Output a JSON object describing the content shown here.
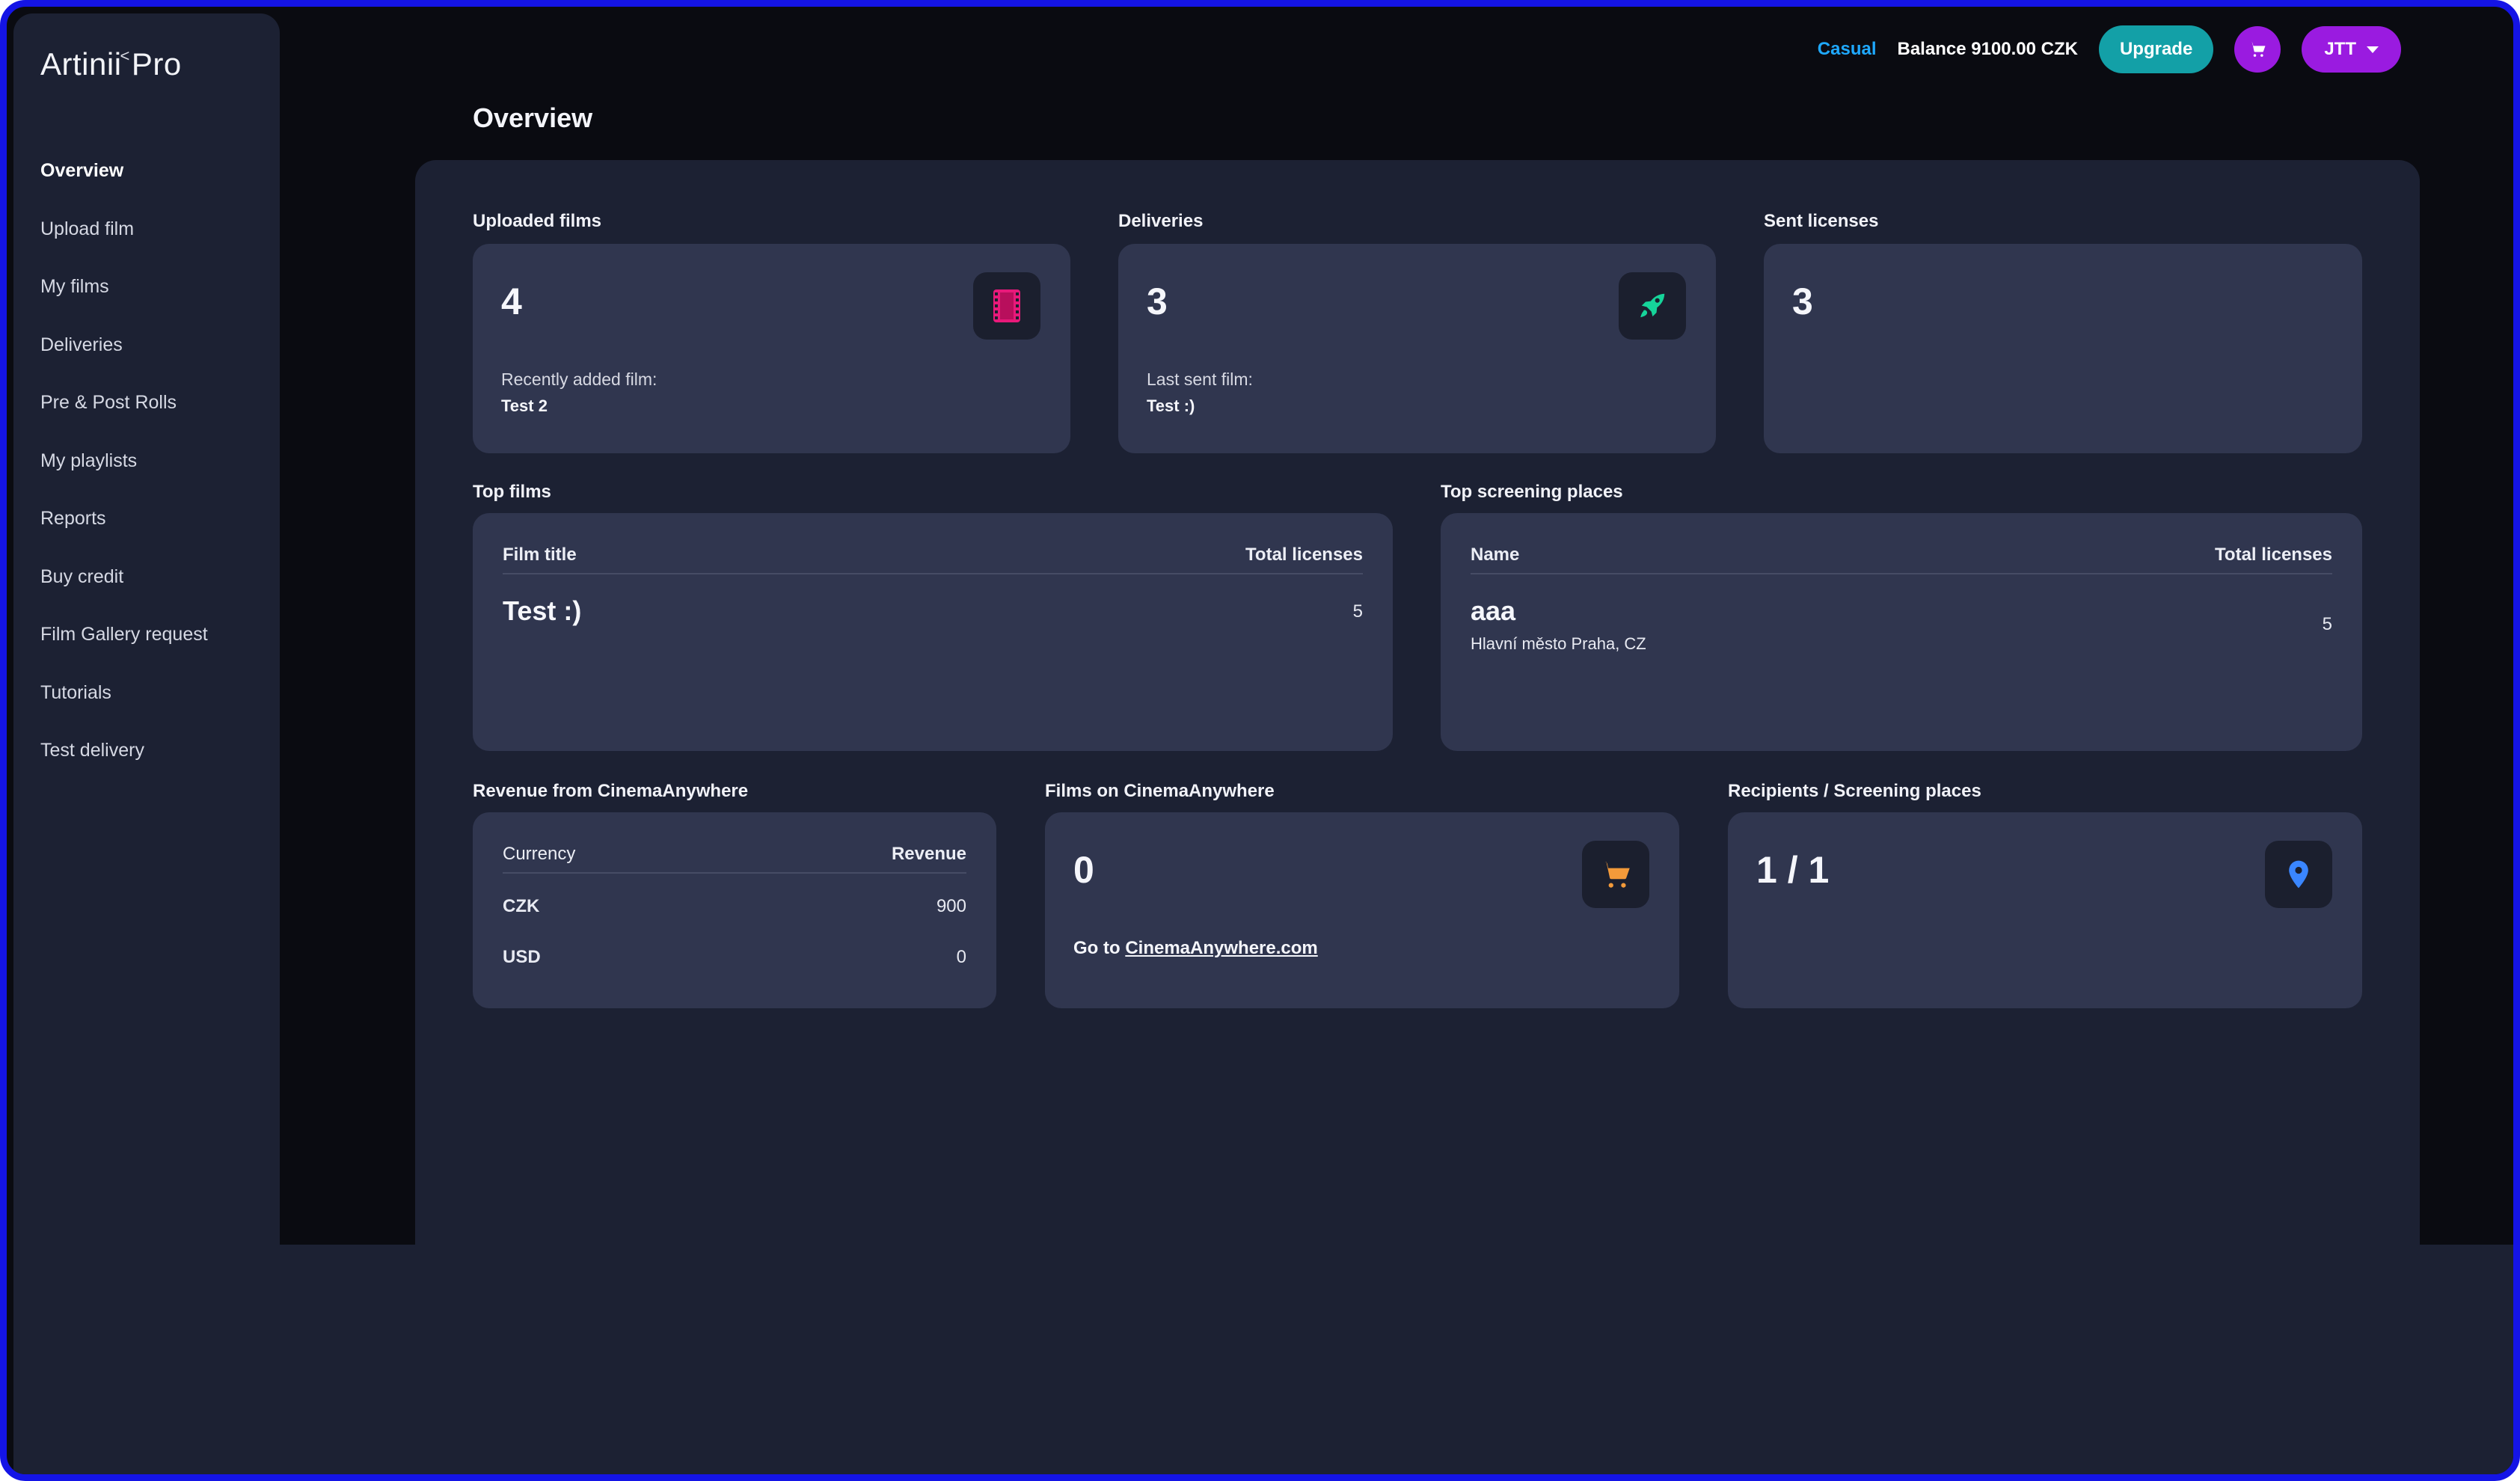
{
  "app": {
    "logo": "Artinii",
    "logo_suffix": "Pro",
    "logo_mark": "˂"
  },
  "sidebar": {
    "items": [
      {
        "label": "Overview",
        "active": true
      },
      {
        "label": "Upload film"
      },
      {
        "label": "My films"
      },
      {
        "label": "Deliveries"
      },
      {
        "label": "Pre & Post Rolls"
      },
      {
        "label": "My playlists"
      },
      {
        "label": "Reports"
      },
      {
        "label": "Buy credit"
      },
      {
        "label": "Film Gallery request"
      },
      {
        "label": "Tutorials"
      },
      {
        "label": "Test delivery"
      }
    ]
  },
  "topbar": {
    "plan": "Casual",
    "balance": "Balance 9100.00 CZK",
    "upgrade_label": "Upgrade",
    "cart_icon": "cart-icon",
    "user_label": "JTT"
  },
  "page": {
    "title": "Overview"
  },
  "stats": {
    "uploaded": {
      "label": "Uploaded films",
      "value": "4",
      "sub_label": "Recently added film:",
      "sub_value": "Test 2",
      "icon": "film-icon",
      "icon_color": "#e8197a"
    },
    "deliveries": {
      "label": "Deliveries",
      "value": "3",
      "sub_label": "Last sent film:",
      "sub_value": "Test :)",
      "icon": "rocket-icon",
      "icon_color": "#16d49a"
    },
    "licenses": {
      "label": "Sent licenses",
      "value": "3"
    }
  },
  "top_films": {
    "label": "Top films",
    "columns": [
      "Film title",
      "Total licenses"
    ],
    "rows": [
      {
        "title": "Test :)",
        "licenses": "5"
      }
    ]
  },
  "top_places": {
    "label": "Top screening places",
    "columns": [
      "Name",
      "Total licenses"
    ],
    "rows": [
      {
        "name": "aaa",
        "location": "Hlavní město Praha, CZ",
        "licenses": "5"
      }
    ]
  },
  "revenue": {
    "label": "Revenue from CinemaAnywhere",
    "columns": [
      "Currency",
      "Revenue"
    ],
    "rows": [
      {
        "currency": "CZK",
        "revenue": "900"
      },
      {
        "currency": "USD",
        "revenue": "0"
      }
    ]
  },
  "cinema_films": {
    "label": "Films on CinemaAnywhere",
    "value": "0",
    "link_prefix": "Go to ",
    "link_text": "CinemaAnywhere.com",
    "icon": "cart-icon",
    "icon_color": "#f39a3a"
  },
  "recipients": {
    "label": "Recipients / Screening places",
    "value": "1 / 1",
    "icon": "location-pin-icon",
    "icon_color": "#3a86ff"
  }
}
